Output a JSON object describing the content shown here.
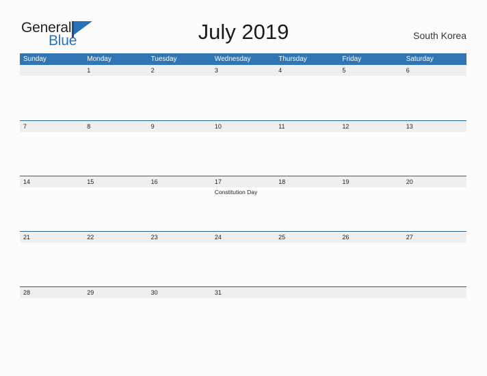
{
  "branding": {
    "name_part1": "General",
    "name_part2": "Blue",
    "flag_icon": "blue-flag-triangle-icon"
  },
  "header": {
    "title": "July 2019",
    "country": "South Korea"
  },
  "colors": {
    "header_blue": "#3075b4",
    "row_divider_blue": "#1f6397",
    "date_strip_gray": "#efefef",
    "logo_blue": "#2a72b5",
    "page_background": "#fcfcfc"
  },
  "calendar": {
    "weekdays": [
      "Sunday",
      "Monday",
      "Tuesday",
      "Wednesday",
      "Thursday",
      "Friday",
      "Saturday"
    ],
    "weeks": [
      [
        {
          "day": "",
          "event": ""
        },
        {
          "day": "1",
          "event": ""
        },
        {
          "day": "2",
          "event": ""
        },
        {
          "day": "3",
          "event": ""
        },
        {
          "day": "4",
          "event": ""
        },
        {
          "day": "5",
          "event": ""
        },
        {
          "day": "6",
          "event": ""
        }
      ],
      [
        {
          "day": "7",
          "event": ""
        },
        {
          "day": "8",
          "event": ""
        },
        {
          "day": "9",
          "event": ""
        },
        {
          "day": "10",
          "event": ""
        },
        {
          "day": "11",
          "event": ""
        },
        {
          "day": "12",
          "event": ""
        },
        {
          "day": "13",
          "event": ""
        }
      ],
      [
        {
          "day": "14",
          "event": ""
        },
        {
          "day": "15",
          "event": ""
        },
        {
          "day": "16",
          "event": ""
        },
        {
          "day": "17",
          "event": "Constitution Day"
        },
        {
          "day": "18",
          "event": ""
        },
        {
          "day": "19",
          "event": ""
        },
        {
          "day": "20",
          "event": ""
        }
      ],
      [
        {
          "day": "21",
          "event": ""
        },
        {
          "day": "22",
          "event": ""
        },
        {
          "day": "23",
          "event": ""
        },
        {
          "day": "24",
          "event": ""
        },
        {
          "day": "25",
          "event": ""
        },
        {
          "day": "26",
          "event": ""
        },
        {
          "day": "27",
          "event": ""
        }
      ],
      [
        {
          "day": "28",
          "event": ""
        },
        {
          "day": "29",
          "event": ""
        },
        {
          "day": "30",
          "event": ""
        },
        {
          "day": "31",
          "event": ""
        },
        {
          "day": "",
          "event": ""
        },
        {
          "day": "",
          "event": ""
        },
        {
          "day": "",
          "event": ""
        }
      ]
    ]
  }
}
